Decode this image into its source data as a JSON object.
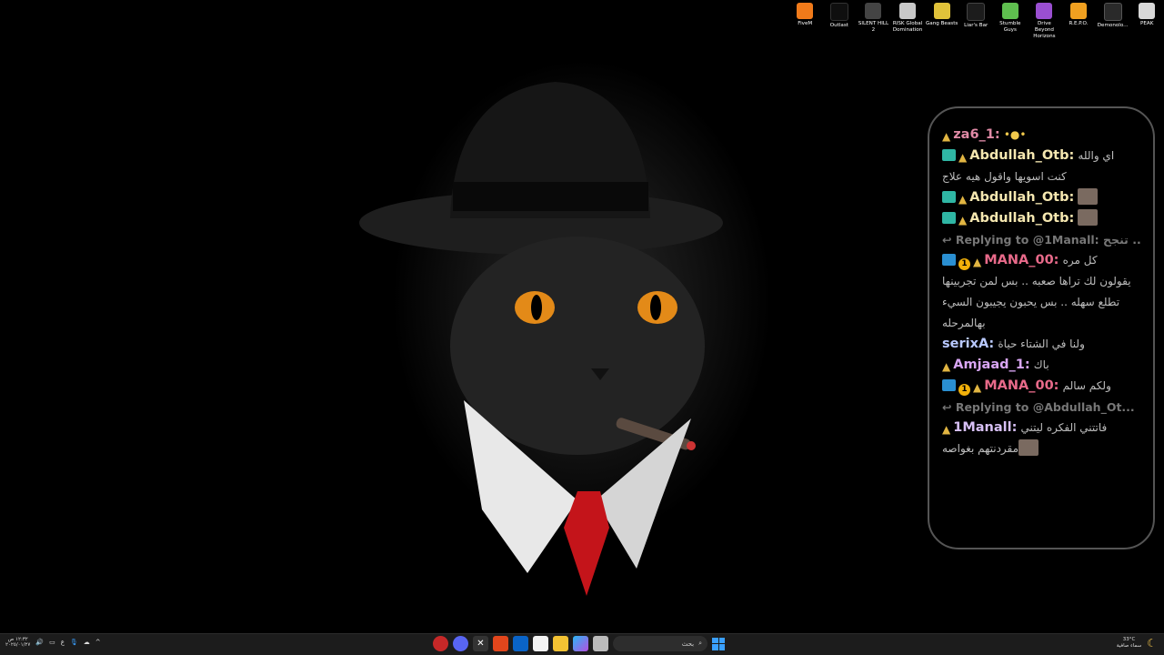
{
  "desktop_icons": [
    {
      "label": "FiveM",
      "color": "#f07a1a",
      "icon": "fivem-icon"
    },
    {
      "label": "Outlast",
      "color": "#0f0f0f",
      "icon": "outlast-icon"
    },
    {
      "label": "SILENT HILL 2",
      "color": "#444444",
      "icon": "silent-hill-icon"
    },
    {
      "label": "RISK Global Domination",
      "color": "#c8c8c8",
      "icon": "risk-icon"
    },
    {
      "label": "Gang Beasts",
      "color": "#e0c23a",
      "icon": "gang-beasts-icon"
    },
    {
      "label": "Liar's Bar",
      "color": "#1c1c1c",
      "icon": "liars-bar-icon"
    },
    {
      "label": "Stumble Guys",
      "color": "#5fbf4f",
      "icon": "stumble-guys-icon"
    },
    {
      "label": "Drive Beyond Horizons",
      "color": "#9a4fd1",
      "icon": "drive-beyond-icon"
    },
    {
      "label": "R.E.P.O.",
      "color": "#f0a020",
      "icon": "repo-icon"
    },
    {
      "label": "Demonolo...",
      "color": "#2a2a2a",
      "icon": "demonologist-icon"
    },
    {
      "label": "PEAK",
      "color": "#d8d8d8",
      "icon": "peak-icon"
    }
  ],
  "chat": {
    "messages": [
      {
        "user": "za6_1:",
        "color": "#e08aa6",
        "badges": [
          "gift"
        ],
        "text": "•●•"
      },
      {
        "user": "Abdullah_Otb:",
        "color": "#f5e7b0",
        "badges": [
          "sub",
          "gift"
        ],
        "text": "اي والله",
        "text2": "كنت اسويها واقول هيه علاج"
      },
      {
        "user": "Abdullah_Otb:",
        "color": "#f5e7b0",
        "badges": [
          "sub",
          "gift"
        ],
        "emote": true
      },
      {
        "user": "Abdullah_Otb:",
        "color": "#f5e7b0",
        "badges": [
          "sub",
          "gift"
        ],
        "emote": true
      },
      {
        "reply": "↩ Replying to @1Manall: تنجح ..."
      },
      {
        "user": "MANA_00:",
        "color": "#e86a8a",
        "badges": [
          "mod",
          "one",
          "gift"
        ],
        "text": "كل مره",
        "text2": "يقولون لك تراها صعبه .. بس لمن تجربينها تطلع سهله .. بس يحبون يجيبون السيء بهالمرحله"
      },
      {
        "user": "serixA:",
        "color": "#b9c9ff",
        "badges": [],
        "text": "ولنا في الشتاء حياة"
      },
      {
        "user": "Amjaad_1:",
        "color": "#d9a6f5",
        "badges": [
          "gift"
        ],
        "text": "باك"
      },
      {
        "user": "MANA_00:",
        "color": "#e86a8a",
        "badges": [
          "mod",
          "one",
          "gift"
        ],
        "text": "ولكم سالم"
      },
      {
        "reply": "↩ Replying to @Abdullah_Ot..."
      },
      {
        "user": "1Manall:",
        "color": "#d7c0f5",
        "badges": [
          "gift"
        ],
        "text": "فاتتني الفكره ليتني",
        "text2": "مقردنتهم بغواصه",
        "emote2": true
      }
    ]
  },
  "taskbar": {
    "search_placeholder": "بحث",
    "clock_time": "١٢:٣٢ ص",
    "clock_date": "٢٠٢٥/٠١/٢٧",
    "lang": "ع",
    "weather_temp": "33°C",
    "weather_desc": "سماء صافية"
  }
}
